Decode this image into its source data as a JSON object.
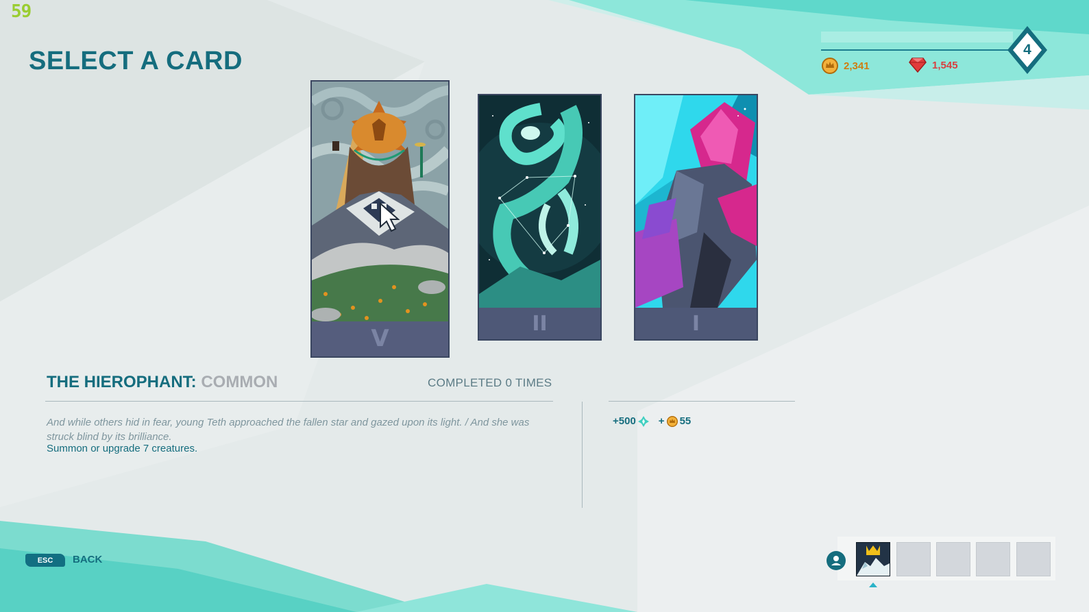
{
  "hud": {
    "fps": "59",
    "level": "4",
    "gold": "2,341",
    "gems": "1,545"
  },
  "page": {
    "title": "SELECT A CARD"
  },
  "cards": [
    {
      "numeral": "V",
      "selected": true
    },
    {
      "numeral": "II",
      "selected": false
    },
    {
      "numeral": "I",
      "selected": false
    }
  ],
  "detail": {
    "name": "THE HIEROPHANT:",
    "rarity": "COMMON",
    "completed": "COMPLETED 0 TIMES",
    "lore": "And while others hid in fear, young Teth approached the fallen star and gazed upon its light. / And she was struck blind by its brilliance.",
    "objective": "Summon or upgrade 7 creatures.",
    "rewards": [
      {
        "amount": "+500",
        "icon": "shard-icon"
      },
      {
        "amount": "55",
        "prefix": "+",
        "icon": "crown-coin-icon"
      }
    ]
  },
  "footer": {
    "esc_key": "ESC",
    "back_label": "BACK"
  },
  "colors": {
    "accent": "#156d7e",
    "gold": "#cf7d10",
    "gem": "#d84040",
    "teal": "#5fe0d0"
  }
}
